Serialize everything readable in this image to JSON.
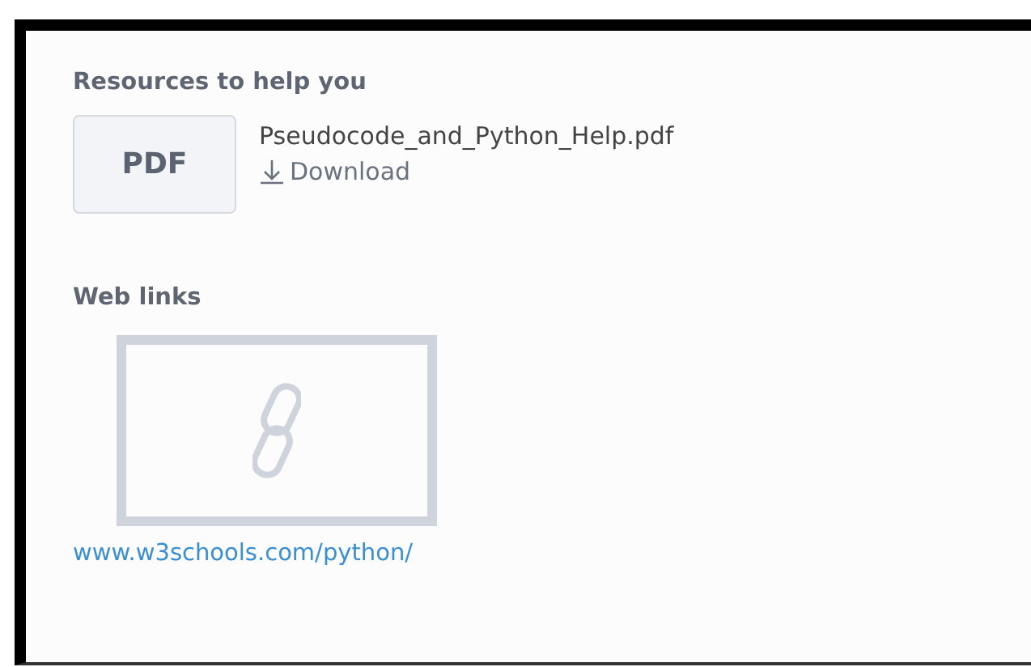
{
  "resources": {
    "heading": "Resources to help you",
    "files": [
      {
        "badge": "PDF",
        "name": "Pseudocode_and_Python_Help.pdf",
        "action": "Download"
      }
    ]
  },
  "web_links": {
    "heading": "Web links",
    "links": [
      {
        "url": "www.w3schools.com/python/"
      }
    ]
  }
}
